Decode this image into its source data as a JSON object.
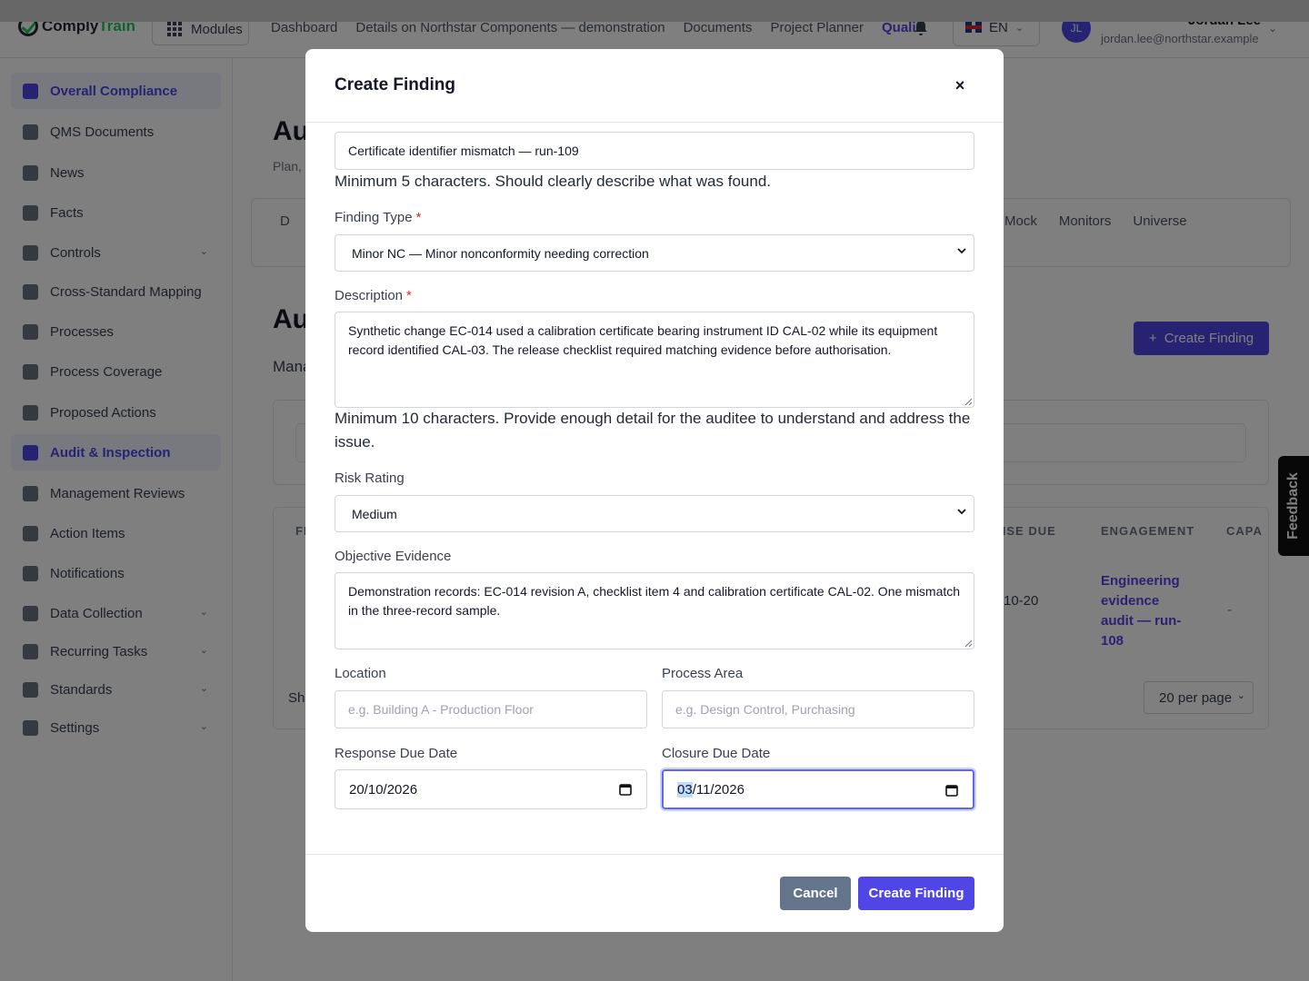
{
  "app": {
    "logo_part1": "Comply",
    "logo_part2": "Train",
    "modules_label": "Modules",
    "top_nav": [
      "Dashboard",
      "Details on Northstar Components — demonstration",
      "Documents",
      "Project Planner",
      "Quali"
    ],
    "language": "EN",
    "user_initials": "JL",
    "user_name": "Jordan Lee",
    "user_email": "jordan.lee@northstar.example"
  },
  "sidebar": {
    "items": [
      {
        "label": "Overall Compliance",
        "icon": "pie-chart-icon",
        "active": true
      },
      {
        "label": "QMS Documents",
        "icon": "document-icon"
      },
      {
        "label": "News",
        "icon": "megaphone-icon"
      },
      {
        "label": "Facts",
        "icon": "lightbulb-icon"
      },
      {
        "label": "Controls",
        "icon": "shield-icon",
        "expandable": true
      },
      {
        "label": "Cross-Standard Mapping",
        "icon": "grid-icon"
      },
      {
        "label": "Processes",
        "icon": "flow-icon"
      },
      {
        "label": "Process Coverage",
        "icon": "table-icon"
      },
      {
        "label": "Proposed Actions",
        "icon": "list-x-icon"
      },
      {
        "label": "Audit & Inspection",
        "icon": "audit-icon",
        "active": true
      },
      {
        "label": "Management Reviews",
        "icon": "chat-icon"
      },
      {
        "label": "Action Items",
        "icon": "checklist-icon"
      },
      {
        "label": "Notifications",
        "icon": "bell-icon"
      },
      {
        "label": "Data Collection",
        "icon": "clipboard-icon",
        "expandable": true
      },
      {
        "label": "Recurring Tasks",
        "icon": "repeat-icon",
        "expandable": true
      },
      {
        "label": "Standards",
        "icon": "bookmark-icon",
        "expandable": true
      },
      {
        "label": "Settings",
        "icon": "gear-icon",
        "expandable": true
      }
    ]
  },
  "background": {
    "heading1": "Au",
    "sub1": "Plan,",
    "heading2": "Au",
    "sub2": "Mana",
    "tabs": [
      "Mock",
      "Monitors",
      "Universe"
    ],
    "tab_d": "D",
    "create_button": "Create Finding",
    "col_f": "FI",
    "col_response": "NSE DUE",
    "col_engagement": "ENGAGEMENT",
    "col_capa": "CAPA",
    "row_date": "10-20",
    "row_engagement": "Engineering evidence audit — run-108",
    "row_capa": "-",
    "footer_show": "She",
    "per_page": "20 per page",
    "feedback": "Feedback"
  },
  "modal": {
    "title": "Create Finding",
    "close": "×",
    "title_value": "Certificate identifier mismatch — run-109",
    "title_help": "Minimum 5 characters. Should clearly describe what was found.",
    "finding_type_label": "Finding Type",
    "finding_type_value": "Minor NC — Minor nonconformity needing correction",
    "description_label": "Description",
    "description_value": "Synthetic change EC-014 used a calibration certificate bearing instrument ID CAL-02 while its equipment record identified CAL-03. The release checklist required matching evidence before authorisation.",
    "description_help": "Minimum 10 characters. Provide enough detail for the auditee to understand and address the issue.",
    "risk_label": "Risk Rating",
    "risk_value": "Medium",
    "evidence_label": "Objective Evidence",
    "evidence_value": "Demonstration records: EC-014 revision A, checklist item 4 and calibration certificate CAL-02. One mismatch in the three-record sample.",
    "location_label": "Location",
    "location_placeholder": "e.g. Building A - Production Floor",
    "process_label": "Process Area",
    "process_placeholder": "e.g. Design Control, Purchasing",
    "response_due_label": "Response Due Date",
    "response_due_value": "20/10/2026",
    "closure_due_label": "Closure Due Date",
    "closure_due_day": "03",
    "closure_due_rest": "/11/2026",
    "required_mark": "*",
    "cancel": "Cancel",
    "submit": "Create Finding"
  },
  "colors": {
    "accent": "#4f46e5",
    "cancel": "#64748b",
    "required": "#dc2626"
  }
}
